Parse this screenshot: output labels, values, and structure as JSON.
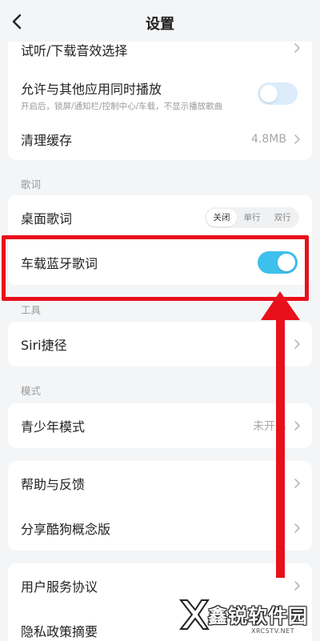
{
  "header": {
    "title": "设置"
  },
  "rows": {
    "audio_effect": "试听/下载音效选择",
    "allow_other_apps": "允许与其他应用同时播放",
    "allow_other_apps_sub": "开启后，锁屏/通知栏/控制中心/车载，不显示播放歌曲",
    "clear_cache": "清理缓存",
    "cache_size": "4.8MB",
    "desktop_lyrics": "桌面歌词",
    "car_bt_lyrics": "车载蓝牙歌词",
    "siri": "Siri捷径",
    "youth_mode": "青少年模式",
    "youth_mode_value": "未开启",
    "help": "帮助与反馈",
    "share": "分享酷狗概念版",
    "user_agreement": "用户服务协议",
    "privacy": "隐私政策摘要"
  },
  "sections": {
    "lyrics": "歌词",
    "tools": "工具",
    "mode": "模式"
  },
  "segmented": {
    "options": [
      "关闭",
      "单行",
      "双行"
    ],
    "selected": "关闭"
  },
  "toggles": {
    "allow_other_apps": false,
    "car_bt_lyrics": true
  },
  "colors": {
    "accent": "#3ec0ec",
    "annotation": "#e8101a"
  },
  "watermark": {
    "text": "鑫锐软件园",
    "url": "XRCSTV.NET"
  }
}
